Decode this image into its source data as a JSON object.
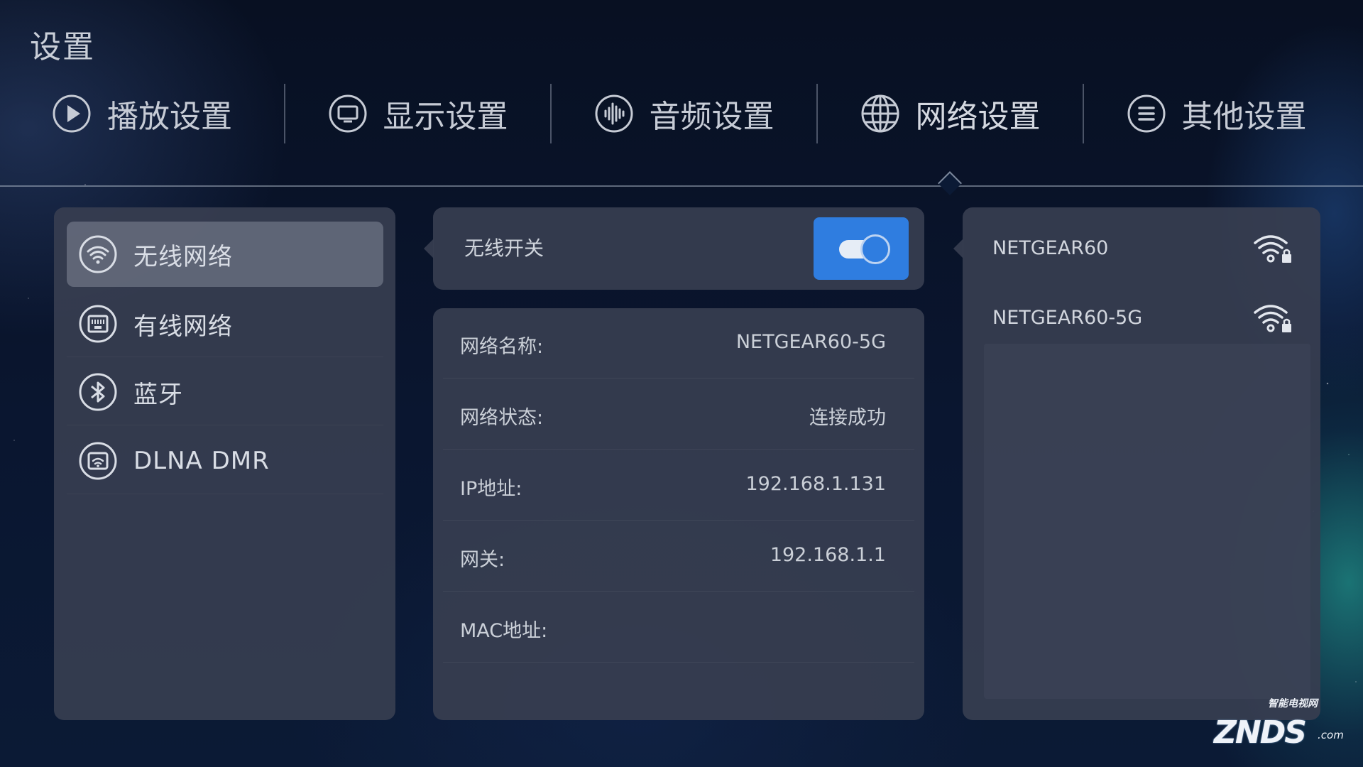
{
  "page_title": "设置",
  "tabs": [
    {
      "label": "播放设置",
      "icon": "play-icon"
    },
    {
      "label": "显示设置",
      "icon": "monitor-icon"
    },
    {
      "label": "音频设置",
      "icon": "audio-waveform-icon"
    },
    {
      "label": "网络设置",
      "icon": "globe-icon",
      "active": true
    },
    {
      "label": "其他设置",
      "icon": "menu-lines-icon"
    }
  ],
  "sidebar": {
    "items": [
      {
        "label": "无线网络",
        "icon": "wifi-icon",
        "selected": true
      },
      {
        "label": "有线网络",
        "icon": "ethernet-icon"
      },
      {
        "label": "蓝牙",
        "icon": "bluetooth-icon"
      },
      {
        "label": "DLNA DMR",
        "icon": "cast-icon"
      }
    ]
  },
  "wireless": {
    "toggle_label": "无线开关",
    "toggle_on": true
  },
  "info": {
    "rows": [
      {
        "key": "网络名称:",
        "value": "NETGEAR60-5G"
      },
      {
        "key": "网络状态:",
        "value": "连接成功"
      },
      {
        "key": "IP地址:",
        "value": "192.168.1.131"
      },
      {
        "key": "网关:",
        "value": "192.168.1.1"
      },
      {
        "key": "MAC地址:",
        "value": ""
      }
    ]
  },
  "networks": [
    {
      "ssid": "NETGEAR60",
      "icon": "wifi-locked-icon"
    },
    {
      "ssid": "NETGEAR60-5G",
      "icon": "wifi-locked-icon"
    }
  ],
  "watermark": {
    "main": "ZNDS",
    "sub": "智能电视网",
    "suffix": ".com"
  },
  "colors": {
    "accent": "#2f7de0",
    "panel": "#373e50",
    "selected_item": "#6e7484"
  }
}
